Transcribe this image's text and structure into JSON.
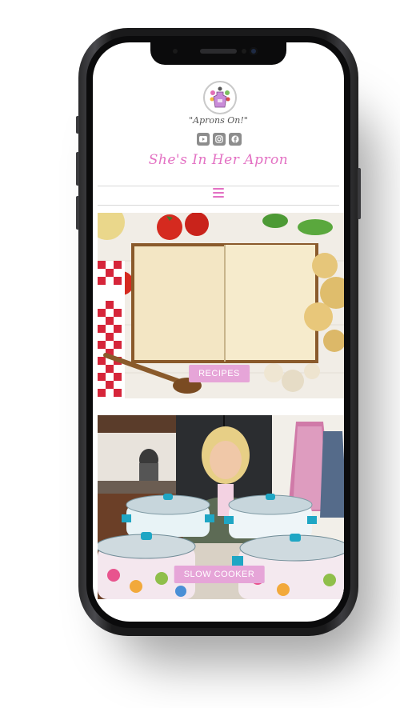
{
  "site": {
    "tagline": "\"Aprons On!\"",
    "title": "She's In Her Apron",
    "logo_icon": "apron-logo-icon"
  },
  "social": [
    {
      "name": "youtube-icon"
    },
    {
      "name": "instagram-icon"
    },
    {
      "name": "facebook-icon"
    }
  ],
  "nav": {
    "menu_icon": "hamburger-menu-icon"
  },
  "tiles": [
    {
      "label": "RECIPES",
      "image": "open-cookbook-with-ingredients"
    },
    {
      "label": "SLOW COOKER",
      "image": "woman-with-slow-cookers-in-kitchen"
    }
  ],
  "colors": {
    "brand_pink": "#e371c3",
    "label_bg": "#e6a5d8",
    "icon_gray": "#8d8d8d"
  }
}
